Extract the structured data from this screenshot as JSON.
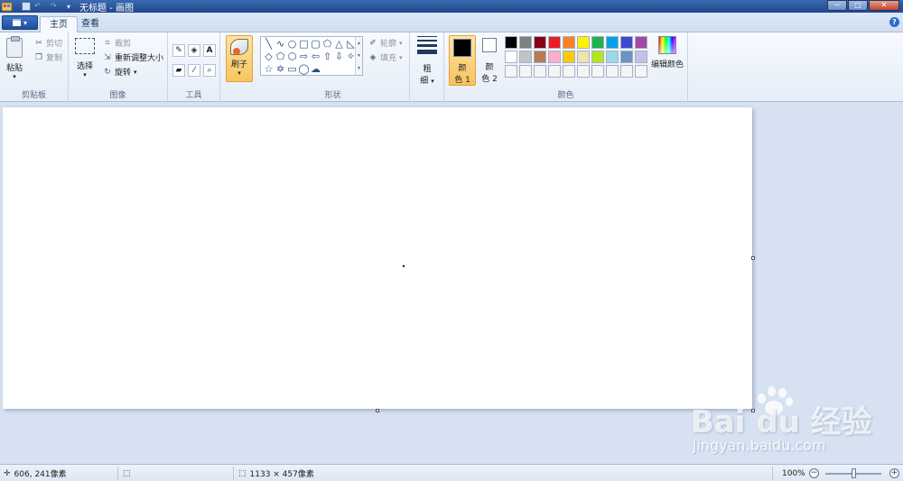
{
  "window": {
    "title": "无标题 - 画图",
    "qat_undo": "↶",
    "qat_redo": "↷",
    "qat_dropdown": "▾",
    "min_label": "─",
    "max_label": "□",
    "close_label": "✕"
  },
  "tabs": [
    {
      "label": "主页"
    },
    {
      "label": "查看"
    }
  ],
  "help_label": "?",
  "ribbon": {
    "clipboard": {
      "group_label": "剪贴板",
      "paste_label": "粘贴",
      "cut_label": "剪切",
      "copy_label": "复制"
    },
    "image": {
      "group_label": "图像",
      "select_label": "选择",
      "crop_label": "裁剪",
      "resize_label": "重新调整大小",
      "rotate_label": "旋转"
    },
    "tools": {
      "group_label": "工具"
    },
    "brushes": {
      "label": "刷子"
    },
    "shapes": {
      "group_label": "形状",
      "outline_label": "轮廓",
      "fill_label": "填充"
    },
    "size": {
      "label_top": "粗",
      "label_bottom": "细"
    },
    "colors": {
      "group_label": "颜色",
      "color1_label_top": "颜",
      "color1_label_bottom": "色 1",
      "color2_label_top": "颜",
      "color2_label_bottom": "色 2",
      "edit_colors_label": "编辑颜色",
      "color1_value": "#000000",
      "color2_value": "#ffffff",
      "palette": [
        "#000000",
        "#7f7f7f",
        "#880015",
        "#ed1c24",
        "#ff7f27",
        "#fff200",
        "#22b14c",
        "#00a2e8",
        "#3f48cc",
        "#a349a4",
        "#ffffff",
        "#c3c3c3",
        "#b97a57",
        "#ffaec9",
        "#ffc90e",
        "#efe4b0",
        "#b5e61d",
        "#99d9ea",
        "#7092be",
        "#c8bfe7",
        "#f5f5f5",
        "#f5f5f5",
        "#f5f5f5",
        "#f5f5f5",
        "#f5f5f5",
        "#f5f5f5",
        "#f5f5f5",
        "#f5f5f5",
        "#f5f5f5",
        "#f5f5f5"
      ]
    }
  },
  "status": {
    "cursor_position": "606, 241像素",
    "canvas_size": "1133 × 457像素",
    "zoom": "100%"
  },
  "watermark": {
    "main": "Bai du 经验",
    "sub": "jingyan.baidu.com"
  }
}
